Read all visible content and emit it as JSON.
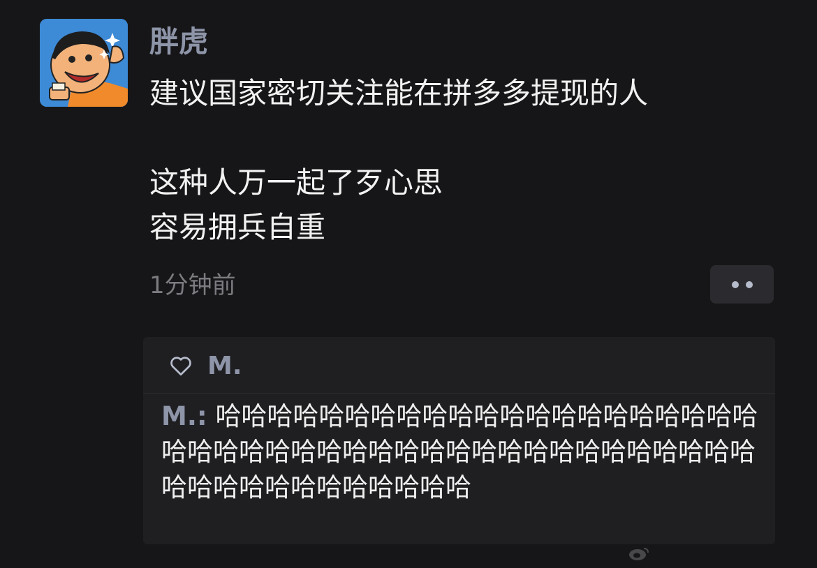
{
  "post": {
    "username": "胖虎",
    "lines": [
      "建议国家密切关注能在拼多多提现的人",
      "",
      "这种人万一起了歹心思",
      "容易拥兵自重"
    ],
    "timestamp": "1分钟前"
  },
  "likes": {
    "icon": "heart-icon",
    "name": "M."
  },
  "comment": {
    "author": "M.:",
    "text": "哈哈哈哈哈哈哈哈哈哈哈哈哈哈哈哈哈哈哈哈哈哈哈哈哈哈哈哈哈哈哈哈哈哈哈哈哈哈哈哈哈哈哈哈哈哈哈哈哈哈哈哈哈哈哈哈"
  },
  "colors": {
    "background": "#161618",
    "accent_name": "#8e95a8",
    "comment_panel": "#1f1f22"
  }
}
